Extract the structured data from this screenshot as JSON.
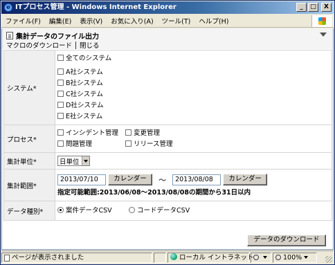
{
  "window": {
    "title": "ITプロセス管理 - Windows Internet Explorer",
    "min_glyph": "_",
    "max_glyph": "□",
    "close_glyph": "X"
  },
  "menu": [
    "ファイル(F)",
    "編集(E)",
    "表示(V)",
    "お気に入り(A)",
    "ツール(T)",
    "ヘルプ(H)"
  ],
  "page": {
    "title": "集計データのファイル出力",
    "links": [
      "マクロのダウンロード",
      "閉じる"
    ]
  },
  "form": {
    "system": {
      "label": "システム",
      "required_mark": "*",
      "all_option": "全てのシステム",
      "options": [
        "A社システム",
        "B社システム",
        "C社システム",
        "D社システム",
        "E社システム"
      ]
    },
    "process": {
      "label": "プロセス",
      "required_mark": "*",
      "options": [
        "インシデント管理",
        "変更管理",
        "問題管理",
        "リリース管理"
      ]
    },
    "unit": {
      "label": "集計単位",
      "required_mark": "*",
      "selected": "日単位"
    },
    "range": {
      "label": "集計範囲",
      "required_mark": "*",
      "start": "2013/07/10",
      "end": "2013/08/08",
      "calendar_button": "カレンダー",
      "tilde": "〜",
      "note": "指定可能範囲:2013/06/08〜2013/08/08の期間から31日以内"
    },
    "data_type": {
      "label": "データ種別",
      "required_mark": "*",
      "options": [
        "案件データCSV",
        "コードデータCSV"
      ],
      "selected_index": 0
    }
  },
  "download_button": "データのダウンロード",
  "status": {
    "text": "ページが表示されました",
    "zone": "ローカル イントラネット",
    "zoom": "100%"
  }
}
